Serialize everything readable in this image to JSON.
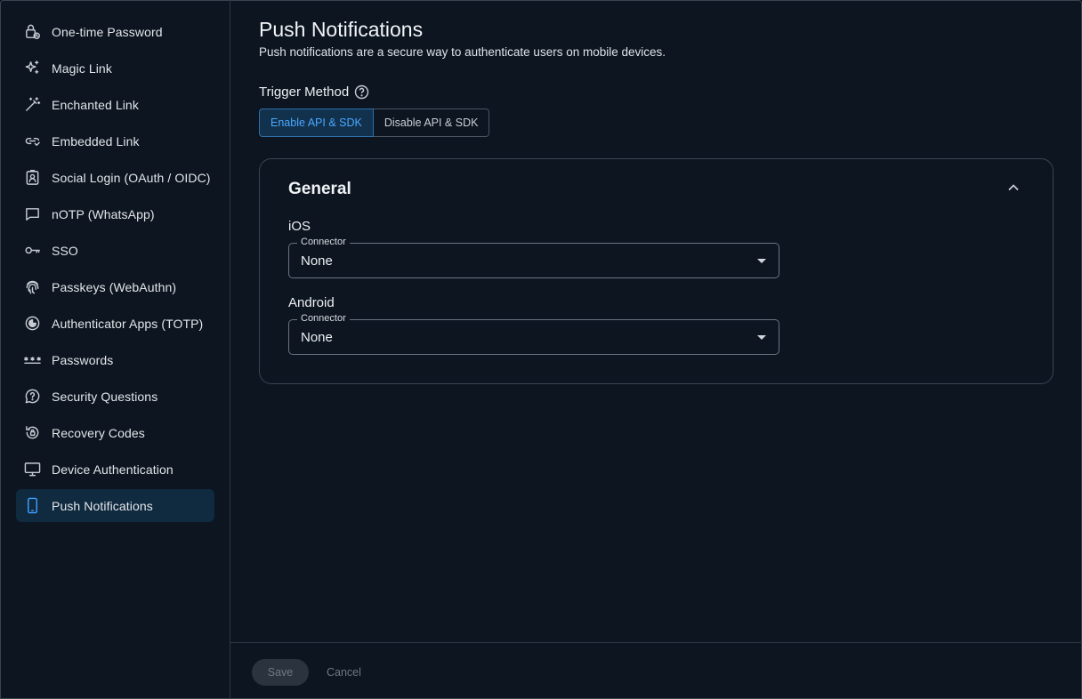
{
  "sidebar": {
    "items": [
      {
        "label": "One-time Password",
        "icon": "lock-clock-icon"
      },
      {
        "label": "Magic Link",
        "icon": "sparkles-icon"
      },
      {
        "label": "Enchanted Link",
        "icon": "magic-wand-icon"
      },
      {
        "label": "Embedded Link",
        "icon": "link-icon"
      },
      {
        "label": "Social Login (OAuth / OIDC)",
        "icon": "contact-badge-icon"
      },
      {
        "label": "nOTP (WhatsApp)",
        "icon": "chat-bubble-icon"
      },
      {
        "label": "SSO",
        "icon": "key-icon"
      },
      {
        "label": "Passkeys (WebAuthn)",
        "icon": "fingerprint-icon"
      },
      {
        "label": "Authenticator Apps (TOTP)",
        "icon": "authenticator-icon"
      },
      {
        "label": "Passwords",
        "icon": "asterisks-icon"
      },
      {
        "label": "Security Questions",
        "icon": "question-bubble-icon"
      },
      {
        "label": "Recovery Codes",
        "icon": "recovery-icon"
      },
      {
        "label": "Device Authentication",
        "icon": "monitor-icon"
      },
      {
        "label": "Push Notifications",
        "icon": "smartphone-icon",
        "active": true
      }
    ],
    "active_color": "#3ea0ff"
  },
  "main": {
    "title": "Push Notifications",
    "description": "Push notifications are a secure way to authenticate users on mobile devices.",
    "trigger": {
      "label": "Trigger Method",
      "options": [
        "Enable API & SDK",
        "Disable API & SDK"
      ],
      "selected": "Enable API & SDK"
    },
    "general": {
      "title": "General",
      "ios": {
        "label": "iOS",
        "field_label": "Connector",
        "value": "None"
      },
      "android": {
        "label": "Android",
        "field_label": "Connector",
        "value": "None"
      }
    }
  },
  "footer": {
    "save_label": "Save",
    "cancel_label": "Cancel"
  }
}
